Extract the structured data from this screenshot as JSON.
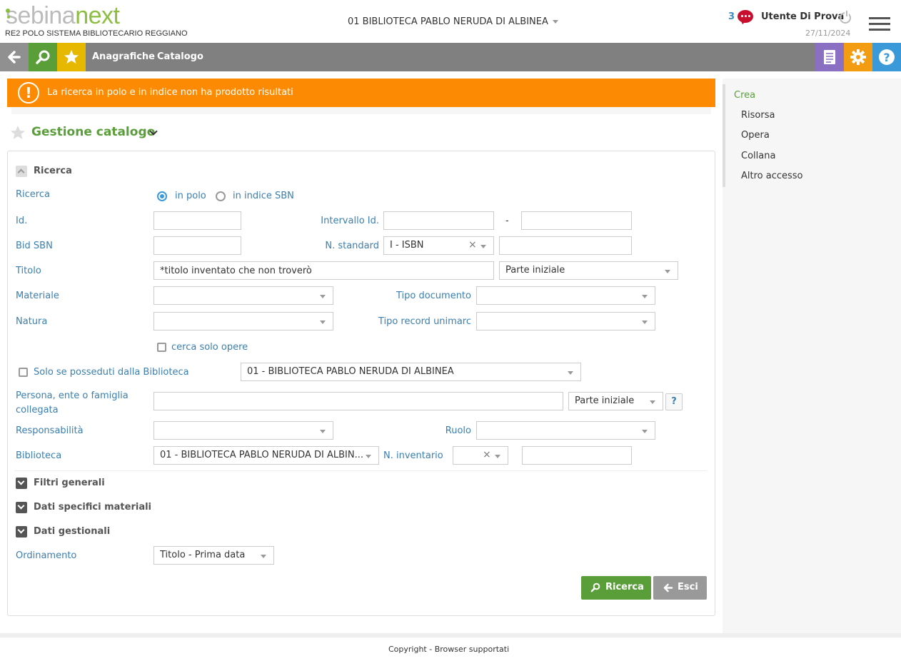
{
  "header": {
    "logo_a": "sebina",
    "logo_b": "next",
    "polo": "RE2 POLO SISTEMA BIBLIOTECARIO REGGIANO",
    "library": "01 BIBLIOTECA PABLO NERUDA DI ALBINEA",
    "messages_count": "3",
    "user": "Utente Di Prova",
    "date": "27/11/2024"
  },
  "nav": {
    "links": [
      "Anagrafiche",
      "Catalogo"
    ]
  },
  "alert": "La ricerca in polo e in indice non ha prodotto risultati",
  "page_title": "Gestione catalogo",
  "search": {
    "section_title": "Ricerca",
    "ricerca_label": "Ricerca",
    "radio_polo": "in polo",
    "radio_indice": "in indice SBN",
    "id_label": "Id.",
    "intervallo_label": "Intervallo Id.",
    "dash": "-",
    "bid_label": "Bid SBN",
    "nstandard_label": "N. standard",
    "nstandard_value": "I - ISBN",
    "titolo_label": "Titolo",
    "titolo_value": "*titolo inventato che non troverò",
    "titolo_mode": "Parte iniziale",
    "materiale_label": "Materiale",
    "tipo_documento_label": "Tipo documento",
    "natura_label": "Natura",
    "tipo_record_label": "Tipo record unimarc",
    "cerca_opere_label": "cerca solo opere",
    "solo_posseduti_label": "Solo se posseduti dalla Biblioteca",
    "posseduti_value": "01 - BIBLIOTECA PABLO NERUDA DI ALBINEA",
    "persona_label": "Persona, ente o famiglia collegata",
    "persona_mode": "Parte iniziale",
    "help_label": "?",
    "responsabilita_label": "Responsabilità",
    "ruolo_label": "Ruolo",
    "biblioteca_label": "Biblioteca",
    "biblioteca_value": "01 - BIBLIOTECA PABLO NERUDA DI ALBIN...",
    "ninventario_label": "N. inventario",
    "filtri_generali": "Filtri generali",
    "dati_specifici": "Dati specifici materiali",
    "dati_gestionali": "Dati gestionali",
    "ordinamento_label": "Ordinamento",
    "ordinamento_value": "Titolo - Prima data",
    "ricerca_button": "Ricerca",
    "esci_button": "Esci"
  },
  "sidebar": {
    "title": "Crea",
    "items": [
      "Risorsa",
      "Opera",
      "Collana",
      "Altro accesso"
    ]
  },
  "footer": {
    "copyright": "Copyright",
    "sep": "-",
    "browser": "Browser supportati"
  },
  "colors": {
    "nav_bg": "#808080",
    "search_btn": "#5a9e3a",
    "favorites_btn": "#e6b800",
    "alert": "#fd8a03",
    "doc_btn": "#8a6fc2",
    "settings_btn": "#f39c12",
    "help_btn": "#3a9ad9"
  }
}
